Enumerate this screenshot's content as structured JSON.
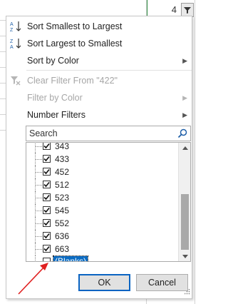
{
  "header_cell": {
    "value": "4"
  },
  "menu": {
    "sort_asc": "Sort Smallest to Largest",
    "sort_desc": "Sort Largest to Smallest",
    "sort_color": "Sort by Color",
    "clear_filter": "Clear Filter From \"422\"",
    "filter_color": "Filter by Color",
    "number_filters": "Number Filters"
  },
  "search": {
    "placeholder": "Search"
  },
  "list": {
    "items": [
      {
        "label": "343",
        "checked": true
      },
      {
        "label": "433",
        "checked": true
      },
      {
        "label": "452",
        "checked": true
      },
      {
        "label": "512",
        "checked": true
      },
      {
        "label": "523",
        "checked": true
      },
      {
        "label": "545",
        "checked": true
      },
      {
        "label": "552",
        "checked": true
      },
      {
        "label": "636",
        "checked": true
      },
      {
        "label": "663",
        "checked": true
      },
      {
        "label": "(Blanks)",
        "checked": false,
        "selected": true
      }
    ]
  },
  "buttons": {
    "ok": "OK",
    "cancel": "Cancel"
  },
  "colors": {
    "selection": "#0b6cc3",
    "accent_green": "#2b8a3e",
    "arrow": "#e02020"
  }
}
